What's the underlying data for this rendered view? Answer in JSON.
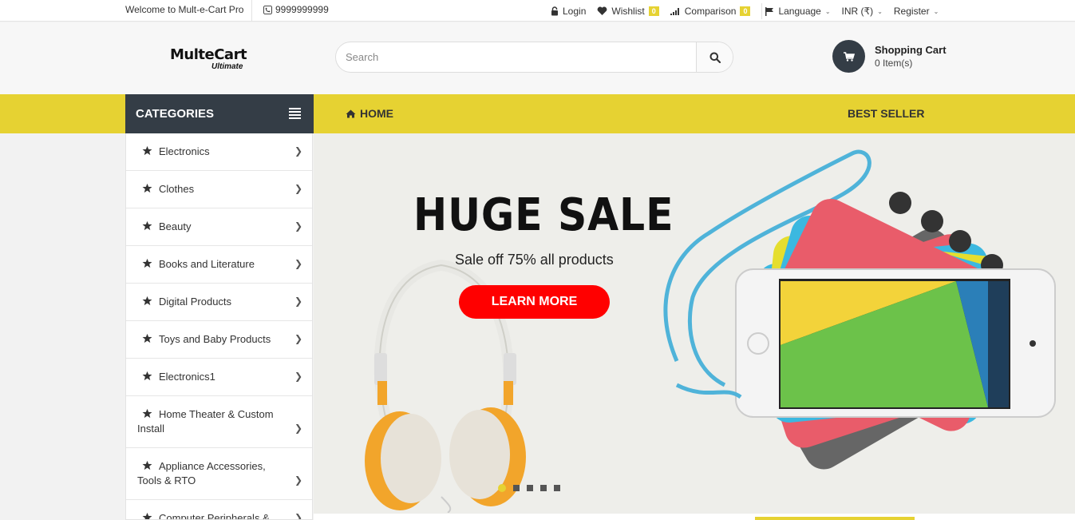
{
  "topbar": {
    "welcome": "Welcome to Mult-e-Cart Pro",
    "phone": "9999999999",
    "login": "Login",
    "wishlist": "Wishlist",
    "wishlist_count": "0",
    "comparison": "Comparison",
    "comparison_count": "0",
    "language": "Language",
    "currency": "INR (₹)",
    "register": "Register"
  },
  "header": {
    "logo_text": "MulteCart",
    "logo_sub": "Ultimate",
    "search_placeholder": "Search",
    "cart_title": "Shopping Cart",
    "cart_items": "0 Item(s)"
  },
  "nav": {
    "categories_label": "CATEGORIES",
    "home": "HOME",
    "best_seller": "BEST SELLER"
  },
  "categories": [
    "Electronics",
    "Clothes",
    "Beauty",
    "Books and Literature",
    "Digital Products",
    "Toys and Baby Products",
    "Electronics1",
    "Home Theater & Custom Install",
    "Appliance Accessories, Tools & RTO",
    "Computer Peripherals &"
  ],
  "banner": {
    "title": "HUGE SALE",
    "subtitle": "Sale off 75% all products",
    "cta": "LEARN MORE",
    "slides": 5,
    "active_slide": 1
  },
  "colors": {
    "accent": "#e6d232",
    "dark": "#343d46",
    "cta": "#ff0000"
  }
}
